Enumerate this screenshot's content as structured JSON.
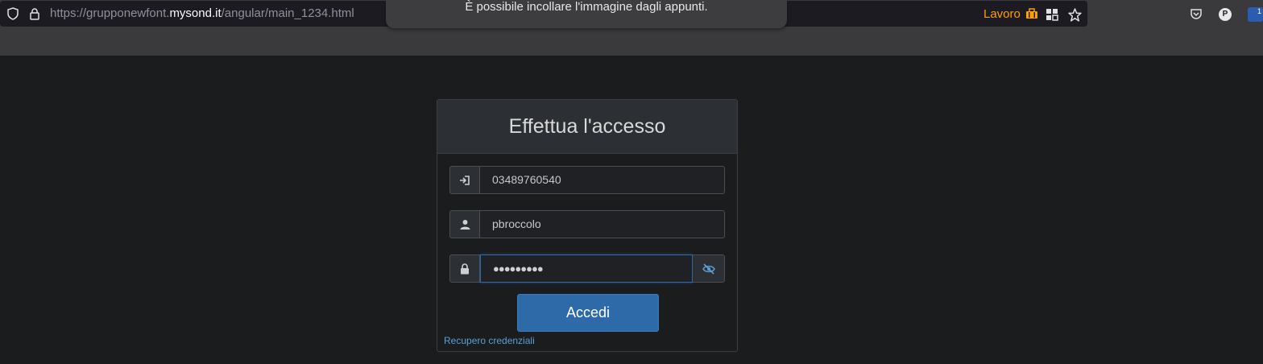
{
  "browser": {
    "url_prefix": "https://grupponewfont.",
    "url_domain": "mysond.it",
    "url_path": "/angular/main_1234.html",
    "notification": "È possibile incollare l'immagine dagli appunti.",
    "container_label": "Lavoro",
    "avatar_letter": "P",
    "extension_badge": "1"
  },
  "login": {
    "title": "Effettua l'accesso",
    "company_code": "03489760540",
    "username": "pbroccolo",
    "password_mask": "●●●●●●●●●",
    "submit_label": "Accedi",
    "recover_link": "Recupero credenziali"
  },
  "colors": {
    "accent": "#2d6aa7",
    "container": "#ff9f00",
    "link": "#5b9fd8"
  }
}
